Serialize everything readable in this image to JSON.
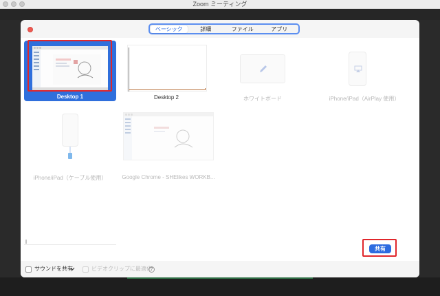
{
  "window": {
    "title": "Zoom ミーティング"
  },
  "tabs": [
    {
      "label": "ベーシック",
      "active": true
    },
    {
      "label": "詳細",
      "active": false
    },
    {
      "label": "ファイル",
      "active": false
    },
    {
      "label": "アプリ",
      "active": false
    }
  ],
  "tiles": [
    {
      "label": "Desktop 1",
      "state": "selected",
      "icon": "desktop-thumbnail"
    },
    {
      "label": "Desktop 2",
      "state": "normal",
      "icon": "desktop-thumbnail"
    },
    {
      "label": "ホワイトボード",
      "state": "disabled",
      "icon": "pencil-icon"
    },
    {
      "label": "iPhone/iPad（AirPlay 使用）",
      "state": "disabled",
      "icon": "airplay-icon"
    },
    {
      "label": "iPhone/iPad（ケーブル使用）",
      "state": "disabled",
      "icon": "cable-icon"
    },
    {
      "label": "Google Chrome - SHElikes WORKB...",
      "state": "disabled",
      "icon": "browser-thumbnail"
    }
  ],
  "footer": {
    "sound_label": "サウンドを共有",
    "video_label": "ビデオクリップに最適化",
    "help": "?"
  },
  "share_button": {
    "label": "共有"
  },
  "colors": {
    "accent": "#2d6be0",
    "highlight": "#e0262b",
    "close": "#ee5a52"
  }
}
